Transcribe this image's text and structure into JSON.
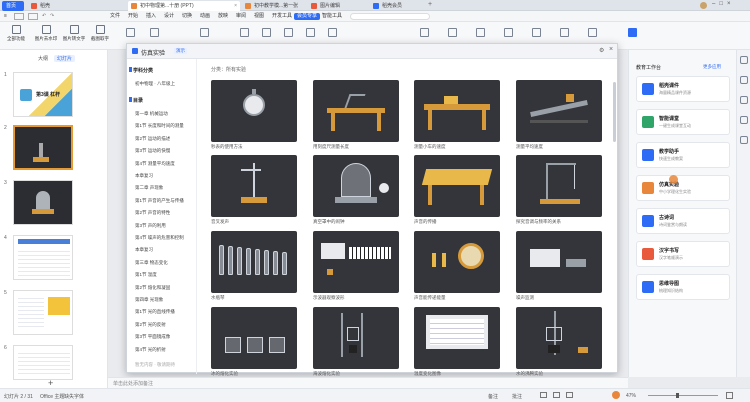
{
  "tabs": [
    {
      "label": "首页",
      "color": "#2f6cf5"
    },
    {
      "label": "稻壳",
      "color": "#e85a3b"
    },
    {
      "label": "初中物理第...十册 (PPT)",
      "color": "#e8873b"
    },
    {
      "label": "初中教学模...第一张",
      "color": "#e8873b"
    },
    {
      "label": "图片编辑",
      "color": "#e85a3b"
    },
    {
      "label": "稻壳会员",
      "color": "#2f6cf5"
    }
  ],
  "menus": [
    "文件",
    "开始",
    "插入",
    "设计",
    "切换",
    "动画",
    "放映",
    "审阅",
    "视图",
    "开发工具",
    "会员专享",
    "智能工具"
  ],
  "active_menu": "会员专享",
  "toolbar": [
    "全部功能",
    "图片去水印",
    "图片转文字",
    "截图取字",
    "PDF转换",
    "一键美化",
    "图片压缩",
    "视频编辑"
  ],
  "left_panel": {
    "tabs": [
      "大纲",
      "幻灯片"
    ],
    "slide_numbers": [
      "1",
      "2",
      "3",
      "4",
      "5",
      "6"
    ],
    "thumb1_title": "第3课 杠杆"
  },
  "dialog": {
    "title": "仿真实验",
    "badge": "演示",
    "breadcrumb": "分类：所有实验",
    "side_header": "学科分类",
    "side_sub": "初中物理 · 八年级上",
    "contents_header": "目录",
    "categories": [
      "第一章 机械运动",
      "第1节 长度和时间的测量",
      "第2节 运动的描述",
      "第3节 运动的快慢",
      "第4节 测量平均速度",
      "本章复习",
      "第二章 声现象",
      "第1节 声音的产生与传播",
      "第2节 声音的特性",
      "第3节 声的利用",
      "第4节 噪声的危害和控制",
      "本章复习",
      "第三章 物态变化",
      "第1节 温度",
      "第2节 熔化和凝固",
      "第四章 光现象",
      "第1节 光的直线传播",
      "第2节 光的反射",
      "第3节 平面镜成像",
      "第4节 光的折射"
    ],
    "footer_hint": "暂无内容 · 敬请期待",
    "cards": [
      {
        "label": "秒表的使用方法",
        "kind": "stopwatch"
      },
      {
        "label": "用刻度尺测量长度",
        "kind": "ruler"
      },
      {
        "label": "测量小车的速度",
        "kind": "cart"
      },
      {
        "label": "测量平均速度",
        "kind": "ramp"
      },
      {
        "label": "音叉发声",
        "kind": "fork"
      },
      {
        "label": "真空罩中的闹钟",
        "kind": "bell"
      },
      {
        "label": "声音的传播",
        "kind": "table"
      },
      {
        "label": "探究音调与频率的关系",
        "kind": "stand"
      },
      {
        "label": "水瓶琴",
        "kind": "bottles"
      },
      {
        "label": "示波器观察波形",
        "kind": "keyboard"
      },
      {
        "label": "声音能传递能量",
        "kind": "drum"
      },
      {
        "label": "噪声监测",
        "kind": "meter"
      },
      {
        "label": "冰的熔化实验",
        "kind": "beakers"
      },
      {
        "label": "海波熔化实验",
        "kind": "burner"
      },
      {
        "label": "温度变化图像",
        "kind": "graph"
      },
      {
        "label": "水的沸腾实验",
        "kind": "boil"
      }
    ]
  },
  "right_panel": {
    "title": "教育工作台",
    "link": "更多应用",
    "items": [
      {
        "title": "稻壳课件",
        "desc": "海量精品课件资源",
        "color": "#2f6cf5"
      },
      {
        "title": "智能课堂",
        "desc": "一键生成课堂互动",
        "color": "#2fa56a"
      },
      {
        "title": "教学助手",
        "desc": "快速生成教案",
        "color": "#2f6cf5"
      },
      {
        "title": "仿真实验",
        "desc": "中小学理化生实验",
        "color": "#e8873b"
      },
      {
        "title": "古诗词",
        "desc": "诗词鉴赏与朗读",
        "color": "#2f6cf5"
      },
      {
        "title": "汉字书写",
        "desc": "汉字笔顺演示",
        "color": "#e85a3b"
      },
      {
        "title": "思维导图",
        "desc": "梳理知识结构",
        "color": "#2f6cf5"
      }
    ]
  },
  "notes_placeholder": "单击此处添加备注",
  "status": {
    "slide": "幻灯片 2 / 31",
    "theme": "Office 主题",
    "font_note": "缺失字体",
    "zoom": "47%",
    "notes": "备注",
    "comment": "批注"
  },
  "colors": {
    "accent": "#2f6cf5",
    "card_bg": "#33353a",
    "wood": "#d69a3a"
  }
}
